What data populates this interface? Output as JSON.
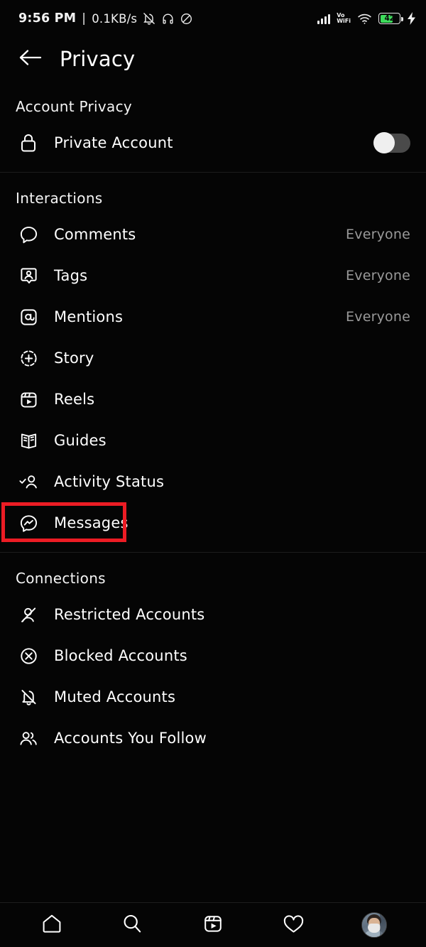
{
  "status_bar": {
    "time": "9:56 PM",
    "separator": "|",
    "data_rate": "0.1KB/s",
    "icons": [
      "bell-off-icon",
      "headphones-icon",
      "dnd-icon"
    ],
    "network_label_top": "Vo",
    "network_label_bottom": "WiFi",
    "battery_percent": "42",
    "battery_color": "#3ddc5b",
    "charging": true
  },
  "header": {
    "back_icon": "arrow-left-icon",
    "title": "Privacy"
  },
  "sections": [
    {
      "title": "Account Privacy",
      "rows": [
        {
          "icon": "lock-icon",
          "label": "Private Account",
          "value": "",
          "control": "toggle",
          "toggle_on": false
        }
      ]
    },
    {
      "title": "Interactions",
      "rows": [
        {
          "icon": "comment-icon",
          "label": "Comments",
          "value": "Everyone",
          "control": "value"
        },
        {
          "icon": "tag-icon",
          "label": "Tags",
          "value": "Everyone",
          "control": "value"
        },
        {
          "icon": "mention-icon",
          "label": "Mentions",
          "value": "Everyone",
          "control": "value"
        },
        {
          "icon": "story-plus-icon",
          "label": "Story",
          "value": "",
          "control": "none"
        },
        {
          "icon": "reels-icon",
          "label": "Reels",
          "value": "",
          "control": "none"
        },
        {
          "icon": "guides-book-icon",
          "label": "Guides",
          "value": "",
          "control": "none"
        },
        {
          "icon": "activity-status-icon",
          "label": "Activity Status",
          "value": "",
          "control": "none"
        },
        {
          "icon": "messenger-icon",
          "label": "Messages",
          "value": "",
          "control": "none",
          "highlighted": true
        }
      ]
    },
    {
      "title": "Connections",
      "rows": [
        {
          "icon": "restricted-account-icon",
          "label": "Restricted Accounts",
          "value": "",
          "control": "none"
        },
        {
          "icon": "blocked-account-icon",
          "label": "Blocked Accounts",
          "value": "",
          "control": "none"
        },
        {
          "icon": "muted-account-icon",
          "label": "Muted Accounts",
          "value": "",
          "control": "none"
        },
        {
          "icon": "accounts-you-follow-icon",
          "label": "Accounts You Follow",
          "value": "",
          "control": "none"
        }
      ]
    }
  ],
  "highlight": {
    "color": "#ec1c24",
    "target_label": "Messages"
  },
  "bottom_nav": [
    {
      "icon": "home-icon",
      "label": "Home"
    },
    {
      "icon": "search-icon",
      "label": "Search"
    },
    {
      "icon": "reels-icon",
      "label": "Reels"
    },
    {
      "icon": "heart-icon",
      "label": "Activity"
    },
    {
      "icon": "profile-avatar",
      "label": "Profile"
    }
  ]
}
